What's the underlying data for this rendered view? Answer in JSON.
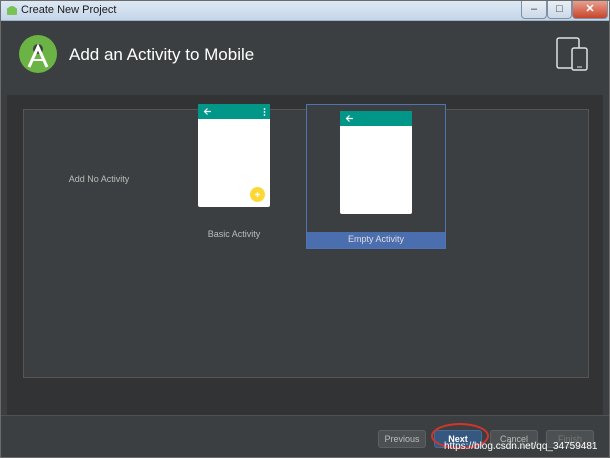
{
  "window": {
    "title": "Create New Project",
    "close_glyph": "✕"
  },
  "header": {
    "heading": "Add an Activity to Mobile",
    "logo_icon": "android-studio-logo-icon",
    "device_icon": "phone-tablet-icon"
  },
  "gallery": {
    "options": [
      {
        "label": "Add No Activity"
      },
      {
        "label": "Basic Activity",
        "has_fab": true,
        "has_overflow_menu": true
      },
      {
        "label": "Empty Activity",
        "selected": true
      }
    ]
  },
  "footer": {
    "previous_label": "Previous",
    "next_label": "Next",
    "cancel_label": "Cancel",
    "finish_label": "Finish"
  },
  "watermark": "https://blog.csdn.net/qq_34759481",
  "colors": {
    "app_bar": "#009688",
    "fab": "#fdd835",
    "selection": "#4b6eaf",
    "highlight_ring": "#d2352b"
  }
}
